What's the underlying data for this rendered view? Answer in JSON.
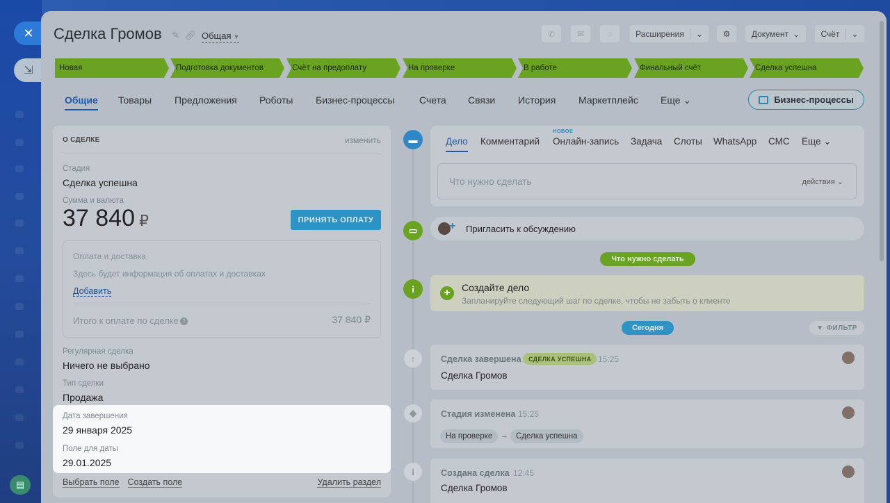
{
  "title": "Сделка Громов",
  "category": "Общая",
  "header_buttons": {
    "extensions": "Расширения",
    "document": "Документ",
    "invoice": "Счёт"
  },
  "stages": [
    "Новая",
    "Подготовка документов",
    "Счёт на предоплату",
    "На проверке",
    "В работе",
    "Финальный счёт",
    "Сделка успешна"
  ],
  "tabs": [
    "Общие",
    "Товары",
    "Предложения",
    "Роботы",
    "Бизнес-процессы",
    "Счета",
    "Связи",
    "История",
    "Маркетплейс",
    "Еще"
  ],
  "bp_button": "Бизнес-процессы",
  "deal": {
    "section_title": "О СДЕЛКЕ",
    "edit": "изменить",
    "stage_label": "Стадия",
    "stage_value": "Сделка успешна",
    "amount_label": "Сумма и валюта",
    "amount_value": "37 840",
    "currency": "₽",
    "pay_button": "ПРИНЯТЬ ОПЛАТУ",
    "payment_title": "Оплата и доставка",
    "payment_info": "Здесь будет информация об оплатах и доставках",
    "payment_add": "Добавить",
    "total_label": "Итого к оплате по сделке",
    "total_value": "37 840 ₽",
    "recurring_label": "Регулярная сделка",
    "recurring_value": "Ничего не выбрано",
    "type_label": "Тип сделки",
    "type_value": "Продажа",
    "close_date_label": "Дата завершения",
    "close_date_value": "29 января 2025",
    "date_field_label": "Поле для даты",
    "date_field_value": "29.01.2025",
    "select_field": "Выбрать поле",
    "create_field": "Создать поле",
    "delete_section": "Удалить раздел"
  },
  "composer": {
    "tabs": [
      "Дело",
      "Комментарий",
      "Онлайн-запись",
      "Задача",
      "Слоты",
      "WhatsApp",
      "СМС",
      "Еще"
    ],
    "new_badge": "НОВОЕ",
    "placeholder": "Что нужно сделать",
    "actions": "действия"
  },
  "invite": "Пригласить к обсуждению",
  "todo_pill": "Что нужно сделать",
  "todo_title": "Создайте дело",
  "todo_subtitle": "Запланируйте следующий шаг по сделке, чтобы не забыть о клиенте",
  "today_pill": "Сегодня",
  "filter": "ФИЛЬТР",
  "events": [
    {
      "title": "Сделка завершена",
      "badge": "СДЕЛКА УСПЕШНА",
      "time": "15:25",
      "body": "Сделка Громов"
    },
    {
      "title": "Стадия изменена",
      "time": "15:25",
      "from": "На проверке",
      "to": "Сделка успешна"
    },
    {
      "title": "Создана сделка",
      "time": "12:45",
      "body": "Сделка Громов"
    }
  ],
  "colors": {
    "stage": "#6aa322",
    "accent": "#2f87c8",
    "highlight": "#f7f8fa"
  }
}
